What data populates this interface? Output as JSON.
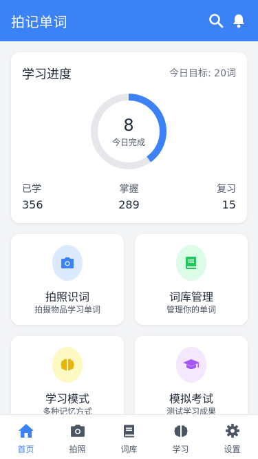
{
  "app": {
    "title": "拍记单词"
  },
  "header": {
    "search_icon": "search-icon",
    "bell_icon": "bell-icon"
  },
  "progress": {
    "title": "学习进度",
    "goal_text": "今日目标: 20词",
    "completed_count": "8",
    "completed_label": "今日完成",
    "goal_fraction": 0.4,
    "stats": [
      {
        "label": "已学",
        "value": "356"
      },
      {
        "label": "掌握",
        "value": "289"
      },
      {
        "label": "复习",
        "value": "15"
      }
    ]
  },
  "features": [
    {
      "title": "拍照识词",
      "subtitle": "拍摄物品学习单词",
      "icon": "camera-icon",
      "bg": "#dbeafe",
      "color": "#3b82f6"
    },
    {
      "title": "词库管理",
      "subtitle": "管理你的单词",
      "icon": "book-icon",
      "bg": "#dcfce7",
      "color": "#22c55e"
    },
    {
      "title": "学习模式",
      "subtitle": "多种记忆方式",
      "icon": "brain-icon",
      "bg": "#fef9c3",
      "color": "#eab308"
    },
    {
      "title": "模拟考试",
      "subtitle": "测试学习成果",
      "icon": "graduation-cap-icon",
      "bg": "#f3e8ff",
      "color": "#a855f7"
    }
  ],
  "tabs": [
    {
      "label": "首页",
      "icon": "home-icon",
      "active": true
    },
    {
      "label": "拍照",
      "icon": "camera-icon",
      "active": false
    },
    {
      "label": "词库",
      "icon": "book-icon",
      "active": false
    },
    {
      "label": "学习",
      "icon": "brain-icon",
      "active": false
    },
    {
      "label": "设置",
      "icon": "gear-icon",
      "active": false
    }
  ],
  "colors": {
    "accent": "#3b82f6",
    "ring_track": "#e5e7eb",
    "inactive_icon": "#4b5563"
  }
}
